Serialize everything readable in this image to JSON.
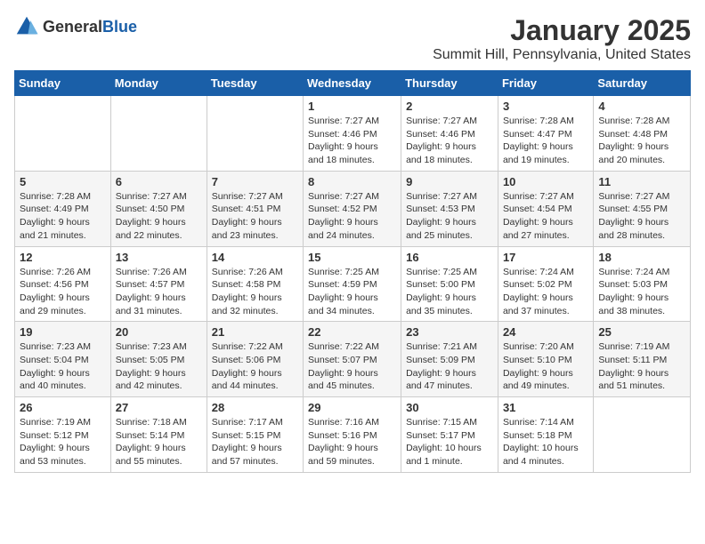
{
  "header": {
    "logo_general": "General",
    "logo_blue": "Blue",
    "title": "January 2025",
    "subtitle": "Summit Hill, Pennsylvania, United States"
  },
  "weekdays": [
    "Sunday",
    "Monday",
    "Tuesday",
    "Wednesday",
    "Thursday",
    "Friday",
    "Saturday"
  ],
  "weeks": [
    [
      {
        "day": "",
        "sunrise": "",
        "sunset": "",
        "daylight": ""
      },
      {
        "day": "",
        "sunrise": "",
        "sunset": "",
        "daylight": ""
      },
      {
        "day": "",
        "sunrise": "",
        "sunset": "",
        "daylight": ""
      },
      {
        "day": "1",
        "sunrise": "Sunrise: 7:27 AM",
        "sunset": "Sunset: 4:46 PM",
        "daylight": "Daylight: 9 hours and 18 minutes."
      },
      {
        "day": "2",
        "sunrise": "Sunrise: 7:27 AM",
        "sunset": "Sunset: 4:46 PM",
        "daylight": "Daylight: 9 hours and 18 minutes."
      },
      {
        "day": "3",
        "sunrise": "Sunrise: 7:28 AM",
        "sunset": "Sunset: 4:47 PM",
        "daylight": "Daylight: 9 hours and 19 minutes."
      },
      {
        "day": "4",
        "sunrise": "Sunrise: 7:28 AM",
        "sunset": "Sunset: 4:48 PM",
        "daylight": "Daylight: 9 hours and 20 minutes."
      }
    ],
    [
      {
        "day": "5",
        "sunrise": "Sunrise: 7:28 AM",
        "sunset": "Sunset: 4:49 PM",
        "daylight": "Daylight: 9 hours and 21 minutes."
      },
      {
        "day": "6",
        "sunrise": "Sunrise: 7:27 AM",
        "sunset": "Sunset: 4:50 PM",
        "daylight": "Daylight: 9 hours and 22 minutes."
      },
      {
        "day": "7",
        "sunrise": "Sunrise: 7:27 AM",
        "sunset": "Sunset: 4:51 PM",
        "daylight": "Daylight: 9 hours and 23 minutes."
      },
      {
        "day": "8",
        "sunrise": "Sunrise: 7:27 AM",
        "sunset": "Sunset: 4:52 PM",
        "daylight": "Daylight: 9 hours and 24 minutes."
      },
      {
        "day": "9",
        "sunrise": "Sunrise: 7:27 AM",
        "sunset": "Sunset: 4:53 PM",
        "daylight": "Daylight: 9 hours and 25 minutes."
      },
      {
        "day": "10",
        "sunrise": "Sunrise: 7:27 AM",
        "sunset": "Sunset: 4:54 PM",
        "daylight": "Daylight: 9 hours and 27 minutes."
      },
      {
        "day": "11",
        "sunrise": "Sunrise: 7:27 AM",
        "sunset": "Sunset: 4:55 PM",
        "daylight": "Daylight: 9 hours and 28 minutes."
      }
    ],
    [
      {
        "day": "12",
        "sunrise": "Sunrise: 7:26 AM",
        "sunset": "Sunset: 4:56 PM",
        "daylight": "Daylight: 9 hours and 29 minutes."
      },
      {
        "day": "13",
        "sunrise": "Sunrise: 7:26 AM",
        "sunset": "Sunset: 4:57 PM",
        "daylight": "Daylight: 9 hours and 31 minutes."
      },
      {
        "day": "14",
        "sunrise": "Sunrise: 7:26 AM",
        "sunset": "Sunset: 4:58 PM",
        "daylight": "Daylight: 9 hours and 32 minutes."
      },
      {
        "day": "15",
        "sunrise": "Sunrise: 7:25 AM",
        "sunset": "Sunset: 4:59 PM",
        "daylight": "Daylight: 9 hours and 34 minutes."
      },
      {
        "day": "16",
        "sunrise": "Sunrise: 7:25 AM",
        "sunset": "Sunset: 5:00 PM",
        "daylight": "Daylight: 9 hours and 35 minutes."
      },
      {
        "day": "17",
        "sunrise": "Sunrise: 7:24 AM",
        "sunset": "Sunset: 5:02 PM",
        "daylight": "Daylight: 9 hours and 37 minutes."
      },
      {
        "day": "18",
        "sunrise": "Sunrise: 7:24 AM",
        "sunset": "Sunset: 5:03 PM",
        "daylight": "Daylight: 9 hours and 38 minutes."
      }
    ],
    [
      {
        "day": "19",
        "sunrise": "Sunrise: 7:23 AM",
        "sunset": "Sunset: 5:04 PM",
        "daylight": "Daylight: 9 hours and 40 minutes."
      },
      {
        "day": "20",
        "sunrise": "Sunrise: 7:23 AM",
        "sunset": "Sunset: 5:05 PM",
        "daylight": "Daylight: 9 hours and 42 minutes."
      },
      {
        "day": "21",
        "sunrise": "Sunrise: 7:22 AM",
        "sunset": "Sunset: 5:06 PM",
        "daylight": "Daylight: 9 hours and 44 minutes."
      },
      {
        "day": "22",
        "sunrise": "Sunrise: 7:22 AM",
        "sunset": "Sunset: 5:07 PM",
        "daylight": "Daylight: 9 hours and 45 minutes."
      },
      {
        "day": "23",
        "sunrise": "Sunrise: 7:21 AM",
        "sunset": "Sunset: 5:09 PM",
        "daylight": "Daylight: 9 hours and 47 minutes."
      },
      {
        "day": "24",
        "sunrise": "Sunrise: 7:20 AM",
        "sunset": "Sunset: 5:10 PM",
        "daylight": "Daylight: 9 hours and 49 minutes."
      },
      {
        "day": "25",
        "sunrise": "Sunrise: 7:19 AM",
        "sunset": "Sunset: 5:11 PM",
        "daylight": "Daylight: 9 hours and 51 minutes."
      }
    ],
    [
      {
        "day": "26",
        "sunrise": "Sunrise: 7:19 AM",
        "sunset": "Sunset: 5:12 PM",
        "daylight": "Daylight: 9 hours and 53 minutes."
      },
      {
        "day": "27",
        "sunrise": "Sunrise: 7:18 AM",
        "sunset": "Sunset: 5:14 PM",
        "daylight": "Daylight: 9 hours and 55 minutes."
      },
      {
        "day": "28",
        "sunrise": "Sunrise: 7:17 AM",
        "sunset": "Sunset: 5:15 PM",
        "daylight": "Daylight: 9 hours and 57 minutes."
      },
      {
        "day": "29",
        "sunrise": "Sunrise: 7:16 AM",
        "sunset": "Sunset: 5:16 PM",
        "daylight": "Daylight: 9 hours and 59 minutes."
      },
      {
        "day": "30",
        "sunrise": "Sunrise: 7:15 AM",
        "sunset": "Sunset: 5:17 PM",
        "daylight": "Daylight: 10 hours and 1 minute."
      },
      {
        "day": "31",
        "sunrise": "Sunrise: 7:14 AM",
        "sunset": "Sunset: 5:18 PM",
        "daylight": "Daylight: 10 hours and 4 minutes."
      },
      {
        "day": "",
        "sunrise": "",
        "sunset": "",
        "daylight": ""
      }
    ]
  ]
}
